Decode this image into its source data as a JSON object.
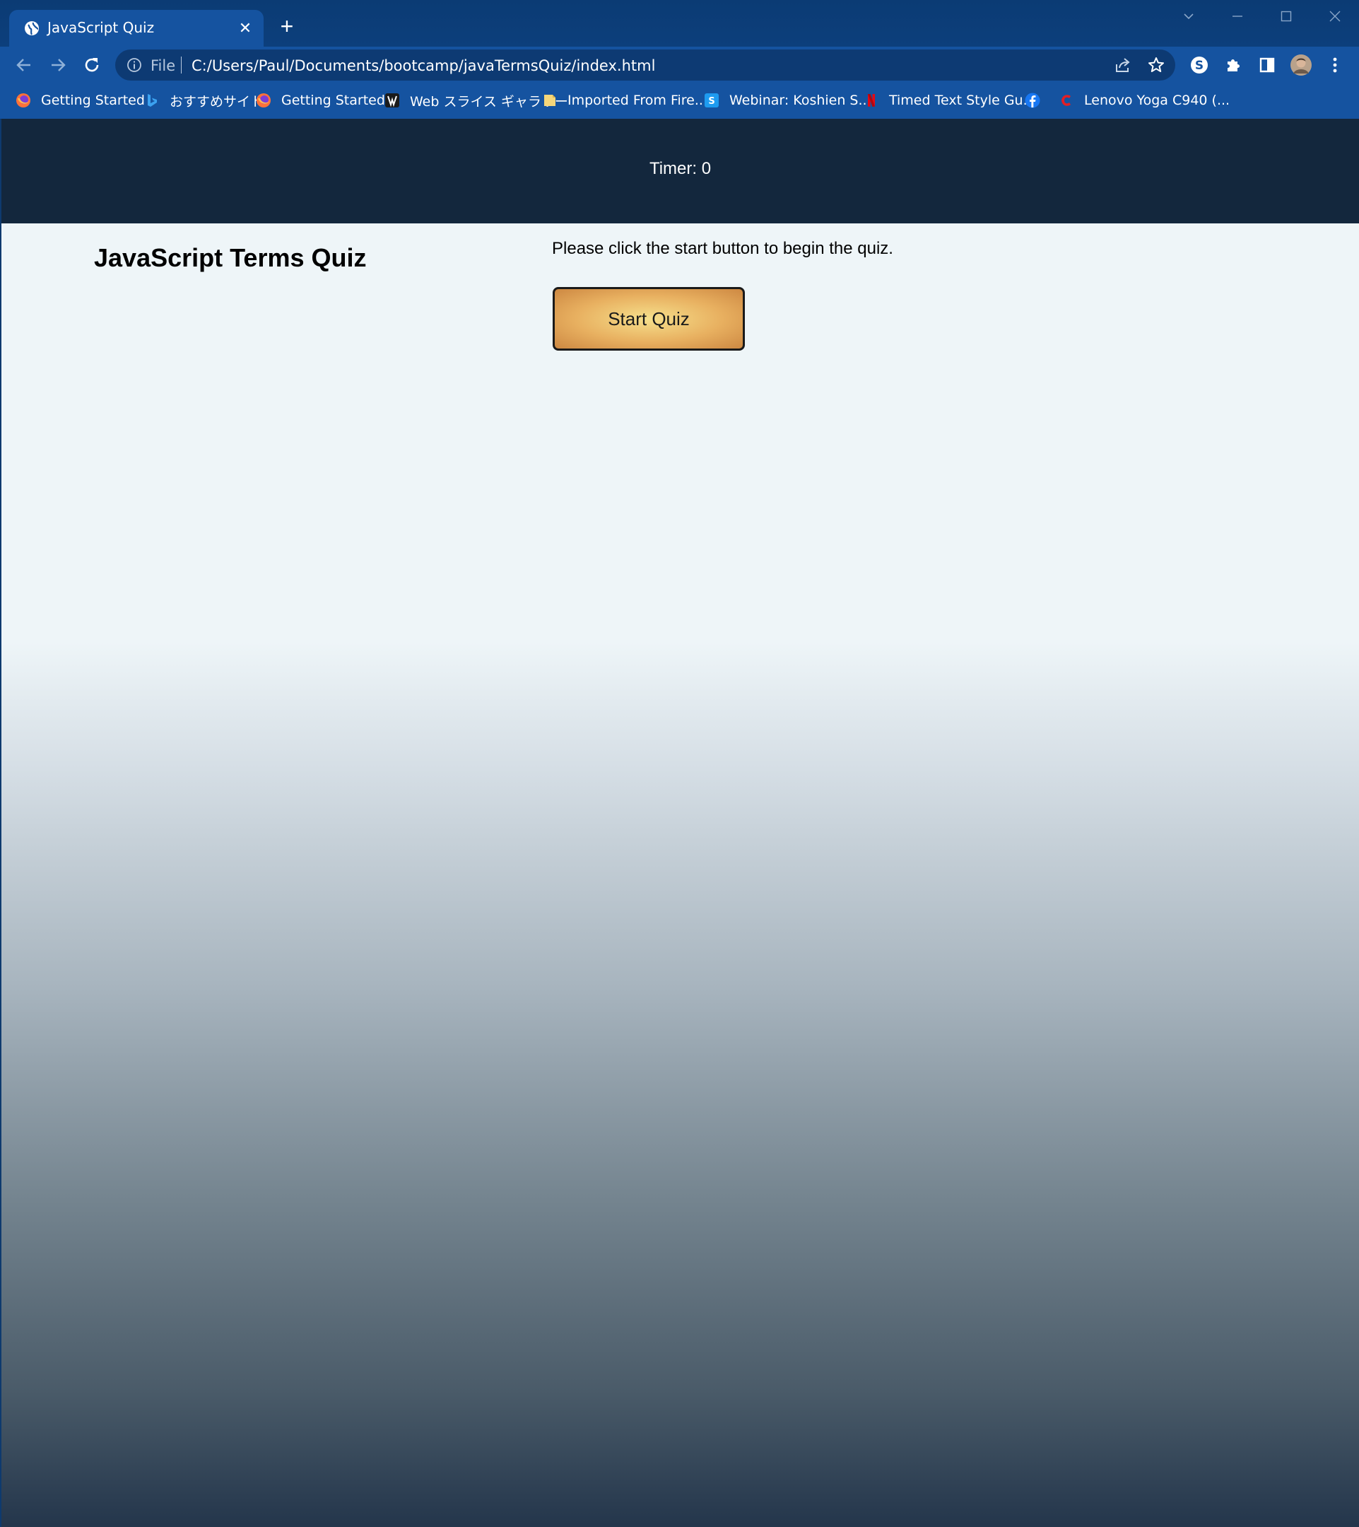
{
  "browser": {
    "tab": {
      "title": "JavaScript Quiz",
      "close_glyph": "✕",
      "favicon": "globe-icon"
    },
    "new_tab_glyph": "+",
    "omnibox": {
      "scheme": "File",
      "url": "C:/Users/Paul/Documents/bootcamp/javaTermsQuiz/index.html"
    },
    "bookmarks": [
      {
        "label": "Getting Started",
        "icon": "firefox-icon"
      },
      {
        "label": "おすすめサイト",
        "icon": "bing-icon"
      },
      {
        "label": "Getting Started",
        "icon": "firefox-icon"
      },
      {
        "label": "Web スライス ギャラリー",
        "icon": "web-slice-icon"
      },
      {
        "label": "Imported From Fire...",
        "icon": "folder-icon"
      },
      {
        "label": "Webinar: Koshien S...",
        "icon": "webinar-icon"
      },
      {
        "label": "Timed Text Style Gu...",
        "icon": "netflix-icon"
      },
      {
        "label": "",
        "icon": "facebook-icon"
      },
      {
        "label": "Lenovo Yoga C940 (...",
        "icon": "c-logo-icon"
      }
    ]
  },
  "page": {
    "timer_text": "Timer: 0",
    "title": "JavaScript Terms Quiz",
    "instructions": "Please click the start button to begin the quiz.",
    "start_button_label": "Start Quiz"
  },
  "colors": {
    "header_bg": "#13273d",
    "button_center": "#f6e08c",
    "button_edge": "#cd8842",
    "browser_accent": "#1553a0"
  }
}
